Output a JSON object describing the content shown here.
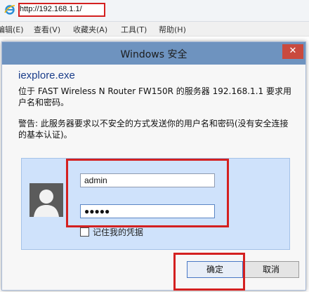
{
  "browser": {
    "url": "http://192.168.1.1/",
    "menu": [
      "编辑(E)",
      "查看(V)",
      "收藏夹(A)",
      "工具(T)",
      "帮助(H)"
    ]
  },
  "dialog": {
    "title": "Windows 安全",
    "close_glyph": "✕",
    "app_name": "iexplore.exe",
    "message": "位于 FAST Wireless N Router FW150R 的服务器 192.168.1.1 要求用户名和密码。",
    "warning": "警告: 此服务器要求以不安全的方式发送你的用户名和密码(没有安全连接的基本认证)。",
    "username": "admin",
    "password_mask": "●●●●●",
    "remember_label": "记住我的凭据",
    "ok_label": "确定",
    "cancel_label": "取消"
  },
  "colors": {
    "highlight": "#d42020",
    "titlebar": "#6e93bf",
    "panel": "#cfe2fb"
  },
  "icons": [
    "ie-logo-icon",
    "close-icon",
    "user-avatar-icon",
    "checkbox"
  ]
}
